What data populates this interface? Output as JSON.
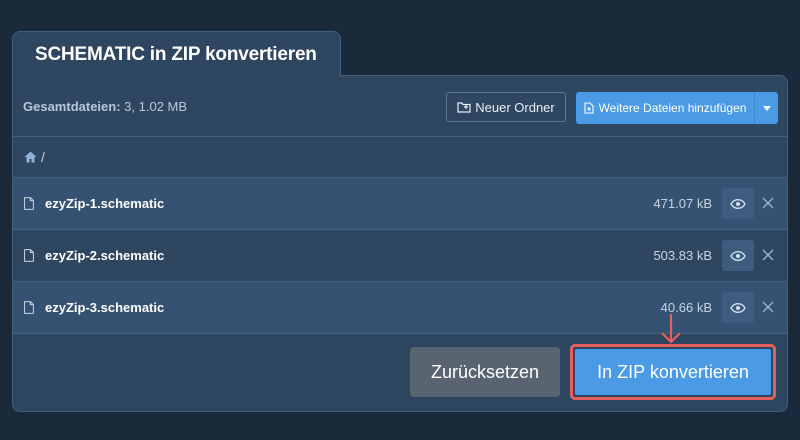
{
  "tab": {
    "title": "SCHEMATIC in ZIP konvertieren"
  },
  "header": {
    "total_label": "Gesamtdateien:",
    "total_value": "3, 1.02 MB",
    "new_folder_label": "Neuer Ordner",
    "add_files_label": "Weitere Dateien hinzufügen"
  },
  "breadcrumb": {
    "root": "/"
  },
  "files": [
    {
      "name": "ezyZip-1.schematic",
      "size": "471.07 kB"
    },
    {
      "name": "ezyZip-2.schematic",
      "size": "503.83 kB"
    },
    {
      "name": "ezyZip-3.schematic",
      "size": "40.66 kB"
    }
  ],
  "footer": {
    "reset_label": "Zurücksetzen",
    "convert_label": "In ZIP konvertieren"
  },
  "colors": {
    "background": "#1a2a3b",
    "panel": "#2f4660",
    "accent": "#4a9ae6",
    "highlight": "#e5605b"
  }
}
